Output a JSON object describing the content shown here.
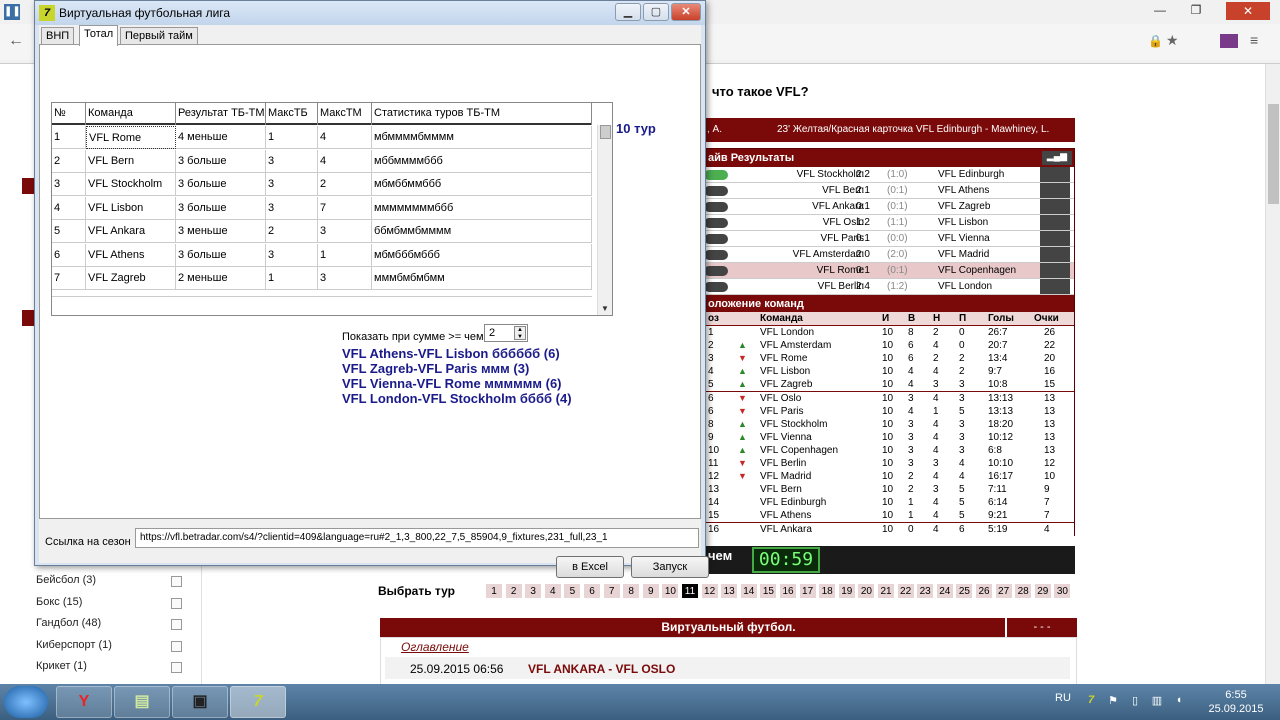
{
  "dialog": {
    "title": "Виртуальная футбольная лига",
    "tabs": [
      "ВНП",
      "Тотал",
      "Первый тайм"
    ],
    "grid": {
      "headers": [
        "№",
        "Команда",
        "Результат ТБ-ТМ",
        "МаксТБ",
        "МаксТМ",
        "Статистика туров ТБ-ТМ"
      ],
      "rows": [
        [
          "1",
          "VFL Rome",
          "4 меньше",
          "1",
          "4",
          "мбммммбмммм"
        ],
        [
          "2",
          "VFL Bern",
          "3 больше",
          "3",
          "4",
          "мббммммббб"
        ],
        [
          "3",
          "VFL Stockholm",
          "3 больше",
          "3",
          "2",
          "мбмббммббб"
        ],
        [
          "4",
          "VFL Lisbon",
          "3 больше",
          "3",
          "7",
          "ммммммммббб"
        ],
        [
          "5",
          "VFL Ankara",
          "3 меньше",
          "2",
          "3",
          "ббмбммбмммм"
        ],
        [
          "6",
          "VFL Athens",
          "3 больше",
          "3",
          "1",
          "мбмбббмббб"
        ],
        [
          "7",
          "VFL Zagreb",
          "2 меньше",
          "1",
          "3",
          "мммбмбмбмм"
        ]
      ]
    },
    "tour_label": "10 тур",
    "sum_label": "Показать при сумме >= чем",
    "sum_value": "2",
    "combos": [
      "VFL Athens-VFL Lisbon бббббб (6)",
      "VFL Zagreb-VFL Paris ммм (3)",
      "VFL Vienna-VFL Rome мммммм (6)",
      "VFL London-VFL Stockholm бббб (4)"
    ],
    "season_label": "Ссылка на сезон",
    "season_url": "https://vfl.betradar.com/s4/?clientid=409&language=ru#2_1,3_800,22_7,5_85904,9_fixtures,231_full,23_1",
    "excel_button": "в Excel",
    "run_button": "Запуск"
  },
  "site": {
    "vfl_question": "что такое VFL?",
    "ticker_left": ", А.",
    "ticker": "23' Желтая/Красная карточка VFL Edinburgh - Mawhiney, L.",
    "live_results_title": "айв Результаты",
    "results": [
      {
        "home": "VFL Stockholm",
        "score": "2:2",
        "ht": "(1:0)",
        "away": "VFL Edinburgh"
      },
      {
        "home": "VFL Bern",
        "score": "2:1",
        "ht": "(0:1)",
        "away": "VFL Athens"
      },
      {
        "home": "VFL Ankara",
        "score": "0:1",
        "ht": "(0:1)",
        "away": "VFL Zagreb"
      },
      {
        "home": "VFL Oslo",
        "score": "1:2",
        "ht": "(1:1)",
        "away": "VFL Lisbon"
      },
      {
        "home": "VFL Paris",
        "score": "0:1",
        "ht": "(0:0)",
        "away": "VFL Vienna"
      },
      {
        "home": "VFL Amsterdam",
        "score": "2:0",
        "ht": "(2:0)",
        "away": "VFL Madrid"
      },
      {
        "home": "VFL Rome",
        "score": "0:1",
        "ht": "(0:1)",
        "away": "VFL Copenhagen"
      },
      {
        "home": "VFL Berlin",
        "score": "2:4",
        "ht": "(1:2)",
        "away": "VFL London"
      }
    ],
    "standings_title": "оложение команд",
    "standings_headers": [
      "оз",
      "Команда",
      "И",
      "В",
      "Н",
      "П",
      "Голы",
      "Очки"
    ],
    "standings": [
      [
        "1",
        "",
        "VFL London",
        "10",
        "8",
        "2",
        "0",
        "26:7",
        "26"
      ],
      [
        "2",
        "up",
        "VFL Amsterdam",
        "10",
        "6",
        "4",
        "0",
        "20:7",
        "22"
      ],
      [
        "3",
        "down",
        "VFL Rome",
        "10",
        "6",
        "2",
        "2",
        "13:4",
        "20"
      ],
      [
        "4",
        "up",
        "VFL Lisbon",
        "10",
        "4",
        "4",
        "2",
        "9:7",
        "16"
      ],
      [
        "5",
        "up",
        "VFL Zagreb",
        "10",
        "4",
        "3",
        "3",
        "10:8",
        "15"
      ],
      [
        "6",
        "down",
        "VFL Oslo",
        "10",
        "3",
        "4",
        "3",
        "13:13",
        "13"
      ],
      [
        "6",
        "down",
        "VFL Paris",
        "10",
        "4",
        "1",
        "5",
        "13:13",
        "13"
      ],
      [
        "8",
        "up",
        "VFL Stockholm",
        "10",
        "3",
        "4",
        "3",
        "18:20",
        "13"
      ],
      [
        "9",
        "up",
        "VFL Vienna",
        "10",
        "3",
        "4",
        "3",
        "10:12",
        "13"
      ],
      [
        "10",
        "up",
        "VFL Copenhagen",
        "10",
        "3",
        "4",
        "3",
        "6:8",
        "13"
      ],
      [
        "11",
        "down",
        "VFL Berlin",
        "10",
        "3",
        "3",
        "4",
        "10:10",
        "12"
      ],
      [
        "12",
        "down",
        "VFL Madrid",
        "10",
        "2",
        "4",
        "4",
        "16:17",
        "10"
      ],
      [
        "13",
        "",
        "VFL Bern",
        "10",
        "2",
        "3",
        "5",
        "7:11",
        "9"
      ],
      [
        "14",
        "",
        "VFL Edinburgh",
        "10",
        "1",
        "4",
        "5",
        "6:14",
        "7"
      ],
      [
        "15",
        "",
        "VFL Athens",
        "10",
        "1",
        "4",
        "5",
        "9:21",
        "7"
      ],
      [
        "16",
        "",
        "VFL Ankara",
        "10",
        "0",
        "4",
        "6",
        "5:19",
        "4"
      ]
    ],
    "timer_label": "чем",
    "timer": "00:59",
    "round_label": "Выбрать тур",
    "rounds": [
      "1",
      "2",
      "3",
      "4",
      "5",
      "6",
      "7",
      "8",
      "9",
      "10",
      "11",
      "12",
      "13",
      "14",
      "15",
      "16",
      "17",
      "18",
      "19",
      "20",
      "21",
      "22",
      "23",
      "24",
      "25",
      "26",
      "27",
      "28",
      "29",
      "30"
    ],
    "active_round": "11",
    "vf_title": "Виртуальный футбол.",
    "vf_dashes": "- - -",
    "toc": "Оглавление",
    "match_date": "25.09.2015 06:56",
    "match_name": "VFL ANKARA - VFL OSLO",
    "sports": [
      {
        "label": "Бейсбол (3)"
      },
      {
        "label": "Бокс (15)"
      },
      {
        "label": "Гандбол (48)"
      },
      {
        "label": "Киберспорт (1)"
      },
      {
        "label": "Крикет (1)"
      }
    ]
  },
  "taskbar": {
    "lang": "RU",
    "time": "6:55",
    "date": "25.09.2015"
  },
  "colors": {
    "site_maroon": "#7a0a0a",
    "combo_blue": "#1a1a8a"
  }
}
